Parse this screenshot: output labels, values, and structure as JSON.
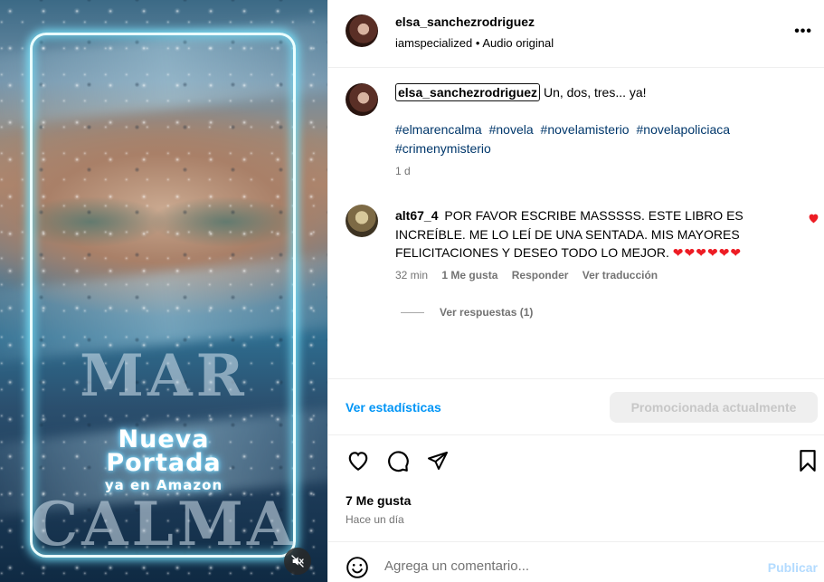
{
  "media": {
    "promo_line1": "Nueva",
    "promo_line2": "Portada",
    "promo_line3": "ya en Amazon",
    "title_word1": "MAR",
    "title_word2": "CALMA",
    "mute_icon": "speaker-muted-icon"
  },
  "header": {
    "username": "elsa_sanchezrodriguez",
    "audio_owner": "iamspecialized",
    "separator": " • ",
    "audio_label": "Audio original",
    "more_label": "•••"
  },
  "caption": {
    "username": "elsa_sanchezrodriguez",
    "text": " Un, dos, tres... ya!",
    "hashtags": [
      "#elmarencalma",
      "#novela",
      "#novelamisterio",
      "#novelapoliciaca",
      "#crimenymisterio"
    ],
    "time": "1 d"
  },
  "comment": {
    "username": "alt67_4",
    "text": "POR FAVOR ESCRIBE MASSSSS. ESTE LIBRO ES INCREÍBLE. ME LO LEÍ DE UNA SENTADA. MIS MAYORES FELICITACIONES Y DESEO TODO LO MEJOR.",
    "hearts": "❤❤❤❤❤❤",
    "time": "32 min",
    "likes": "1 Me gusta",
    "reply": "Responder",
    "translate": "Ver traducción",
    "view_replies": "Ver respuestas (1)"
  },
  "stats": {
    "view_stats": "Ver estadísticas",
    "promoted": "Promocionada actualmente"
  },
  "post": {
    "likes": "7 Me gusta",
    "posted": "Hace un día"
  },
  "comment_box": {
    "placeholder": "Agrega un comentario...",
    "publish": "Publicar"
  },
  "colors": {
    "link_blue": "#0095f6",
    "hashtag_blue": "#00376b",
    "secondary_text": "#737373",
    "heart_red": "#ed1c24",
    "publish_disabled": "#b3dbff"
  }
}
